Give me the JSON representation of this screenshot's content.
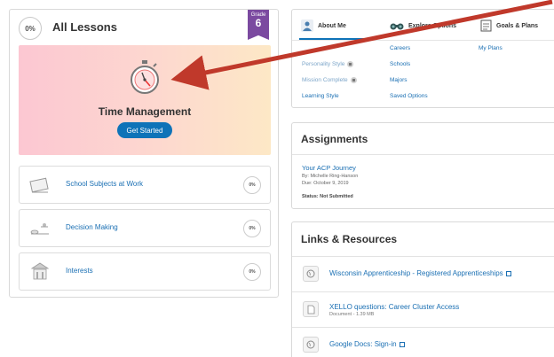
{
  "lessons_panel": {
    "progress": "0%",
    "title": "All Lessons",
    "grade_label": "Grade",
    "grade_value": "6",
    "featured": {
      "title": "Time Management",
      "button": "Get Started"
    },
    "items": [
      {
        "label": "School Subjects at Work",
        "progress": "0%"
      },
      {
        "label": "Decision Making",
        "progress": "0%"
      },
      {
        "label": "Interests",
        "progress": "0%"
      }
    ]
  },
  "about_card": {
    "tabs": [
      "About Me",
      "Explore Options",
      "Goals & Plans"
    ],
    "about_me_links": [
      "Personality Style",
      "Mission Complete",
      "Learning Style"
    ],
    "explore_links": [
      "Careers",
      "Schools",
      "Majors",
      "Saved Options"
    ],
    "goals_links": [
      "My Plans"
    ]
  },
  "assignments": {
    "title": "Assignments",
    "item": {
      "title": "Your ACP Journey",
      "by": "By: Michelle Ring-Hanson",
      "due": "Due: October 9, 2019",
      "status": "Status: Not Submitted"
    }
  },
  "links_resources": {
    "title": "Links & Resources",
    "items": [
      {
        "label": "Wisconsin Apprenticeship - Registered Apprenticeships",
        "sub": "",
        "icon": "globe-icon"
      },
      {
        "label": "XELLO questions: Career Cluster Access",
        "sub": "Document - 1.39 MB",
        "icon": "document-icon"
      },
      {
        "label": "Google Docs: Sign-in",
        "sub": "",
        "icon": "globe-icon"
      }
    ]
  },
  "colors": {
    "accent": "#0e73b8",
    "grade_badge": "#7b4aa0",
    "arrow": "#c0392b"
  }
}
